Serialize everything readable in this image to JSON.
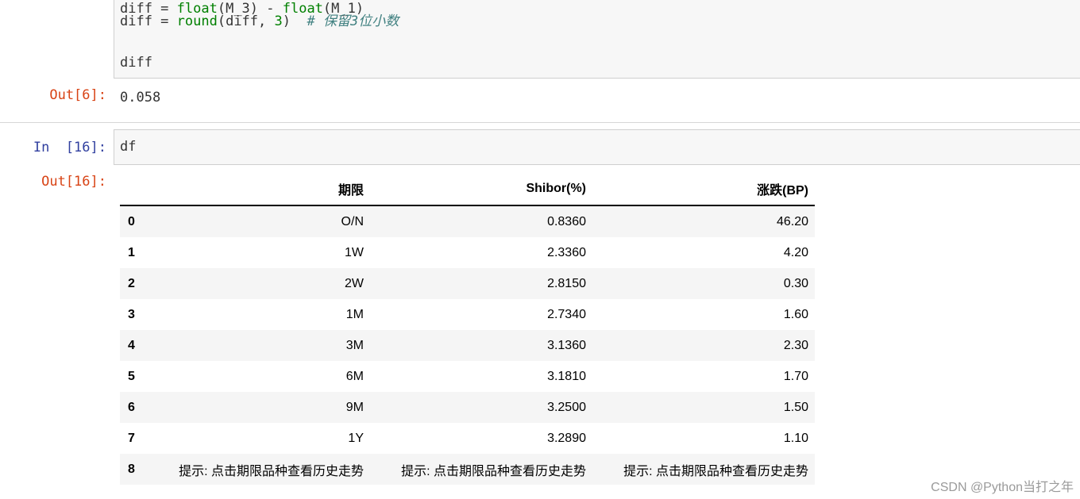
{
  "code_cell": {
    "line1_prefix": "diff = ",
    "line1_fn1": "float",
    "line1_arg1": "(M_3) - ",
    "line1_fn2": "float",
    "line1_arg2": "(M_1)",
    "line2_prefix": "diff = ",
    "line2_fn": "round",
    "line2_args": "(diff, ",
    "line2_num": "3",
    "line2_close": ")",
    "line2_comment": "# 保留3位小数",
    "line3": "diff"
  },
  "out6": {
    "prompt": "Out[6]:",
    "value": "0.058"
  },
  "in16": {
    "prompt": "In  [16]:",
    "code": "df"
  },
  "out16": {
    "prompt": "Out[16]:"
  },
  "table": {
    "headers": [
      "",
      "期限",
      "Shibor(%)",
      "涨跌(BP)"
    ],
    "rows": [
      [
        "0",
        "O/N",
        "0.8360",
        "46.20"
      ],
      [
        "1",
        "1W",
        "2.3360",
        "4.20"
      ],
      [
        "2",
        "2W",
        "2.8150",
        "0.30"
      ],
      [
        "3",
        "1M",
        "2.7340",
        "1.60"
      ],
      [
        "4",
        "3M",
        "3.1360",
        "2.30"
      ],
      [
        "5",
        "6M",
        "3.1810",
        "1.70"
      ],
      [
        "6",
        "9M",
        "3.2500",
        "1.50"
      ],
      [
        "7",
        "1Y",
        "3.2890",
        "1.10"
      ],
      [
        "8",
        "提示: 点击期限品种查看历史走势",
        "提示: 点击期限品种查看历史走势",
        "提示: 点击期限品种查看历史走势"
      ]
    ]
  },
  "watermark": "CSDN @Python当打之年",
  "colors": {
    "out_prompt": "#d84315",
    "in_prompt": "#303f9f",
    "cell_bg": "#f7f7f7",
    "row_alt": "#f5f5f5"
  }
}
